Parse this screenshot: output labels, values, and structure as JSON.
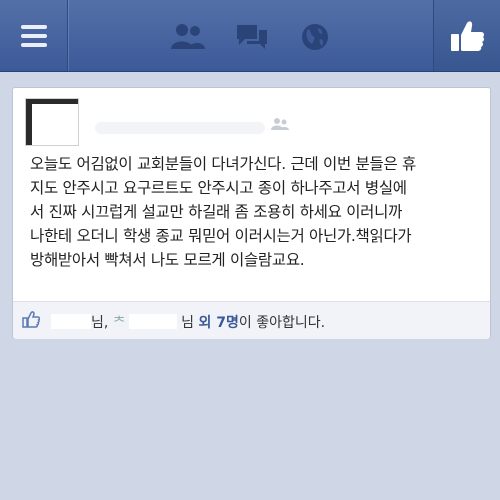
{
  "topbar": {
    "icons": [
      "menu-icon",
      "friend-requests-icon",
      "messages-icon",
      "notifications-globe-icon",
      "like-thumb-icon"
    ],
    "bar_color": "#3c5a99"
  },
  "post": {
    "text": "오늘도 어김없이 교회분들이 다녀가신다. 근데 이번 분들은 휴\n지도 안주시고 요구르트도 안주시고 종이 하나주고서 병실에\n서 진짜 시끄럽게 설교만 하길래 좀 조용히 하세요 이러니까\n나한테 오더니 학생 종교 뭐믿어 이러시는거 아닌가.책읽다가\n방해받아서 빡쳐서 나도 모르게 이슬람교요.",
    "privacy_icon": "friends-privacy-icon"
  },
  "likes": {
    "suffix1": "님,",
    "prefix2": "ᄎ",
    "suffix2": "님",
    "others": "외 7명",
    "tail": "이 좋아합니다."
  }
}
